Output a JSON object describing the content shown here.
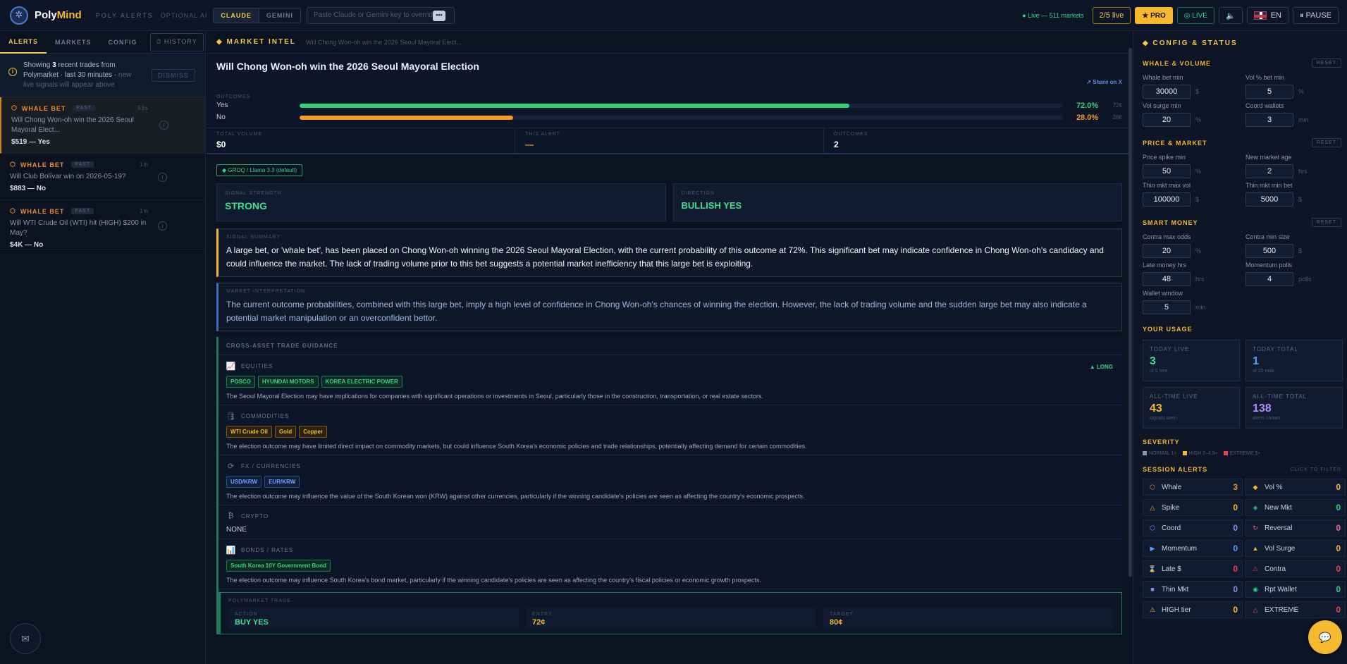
{
  "header": {
    "brand_a": "Poly",
    "brand_b": "Mind",
    "subtitle": "POLY ALERTS",
    "optional": "OPTIONAL AI",
    "seg_claude": "CLAUDE",
    "seg_gemini": "GEMINI",
    "key_placeholder": "Paste Claude or Gemini key to override",
    "key_btn": "•••",
    "live_markets": "● Live — 511 markets",
    "live_count": "2/5 live",
    "pro": "★ PRO",
    "live": "◎ LIVE",
    "sound": "🔈",
    "lang": "EN",
    "pause": "⏸ PAUSE"
  },
  "left": {
    "tabs": [
      "ALERTS",
      "MARKETS",
      "CONFIG"
    ],
    "history": "⏱ HISTORY",
    "notice_a": "Showing ",
    "notice_count": "3",
    "notice_b": " recent trades from Polymarket · last 30 minutes · ",
    "notice_muted": "new live signals will appear above",
    "dismiss": "DISMISS",
    "alerts": [
      {
        "type": "WHALE BET",
        "badge": "PAST",
        "age": "53s",
        "title": "Will Chong Won-oh win the 2026 Seoul Mayoral Elect...",
        "value": "$519 — Yes"
      },
      {
        "type": "WHALE BET",
        "badge": "PAST",
        "age": "1m",
        "title": "Will Club Bolívar win on 2026-05-19?",
        "value": "$883 — No"
      },
      {
        "type": "WHALE BET",
        "badge": "PAST",
        "age": "1m",
        "title": "Will WTI Crude Oil (WTI) hit (HIGH) $200 in May?",
        "value": "$4K — No"
      }
    ]
  },
  "center": {
    "section": "MARKET INTEL",
    "crumb": "Will Chong Won-oh win the 2026 Seoul Mayoral Elect...",
    "title": "Will Chong Won-oh win the 2026 Seoul Mayoral Election",
    "share": "↗ Share on X",
    "outcomes_label": "OUTCOMES",
    "outcomes": [
      {
        "name": "Yes",
        "pct": "72.0%",
        "pct_value": 0.72,
        "cents": "72¢",
        "color": "#2fd27a"
      },
      {
        "name": "No",
        "pct": "28.0%",
        "pct_value": 0.28,
        "cents": "28¢",
        "color": "#f39a2b"
      }
    ],
    "stats": [
      {
        "label": "TOTAL VOLUME",
        "value": "$0",
        "color": "#ffffff"
      },
      {
        "label": "THIS ALERT",
        "value": "—",
        "color": "#f39a2b"
      },
      {
        "label": "OUTCOMES",
        "value": "2",
        "color": "#ffffff"
      }
    ],
    "model": "◆ GROQ / Llama 3.3 (default)",
    "strength_label": "SIGNAL STRENGTH",
    "strength": "STRONG",
    "direction_label": "DIRECTION",
    "direction": "BULLISH YES",
    "summary_label": "SIGNAL SUMMARY",
    "summary": "A large bet, or 'whale bet', has been placed on Chong Won-oh winning the 2026 Seoul Mayoral Election, with the current probability of this outcome at 72%. This significant bet may indicate confidence in Chong Won-oh's candidacy and could influence the market. The lack of trading volume prior to this bet suggests a potential market inefficiency that this large bet is exploiting.",
    "interp_label": "MARKET INTERPRETATION",
    "interp": "The current outcome probabilities, combined with this large bet, imply a high level of confidence in Chong Won-oh's chances of winning the election. However, the lack of trading volume and the sudden large bet may also indicate a potential market manipulation or an overconfident bettor.",
    "xa_label": "CROSS-ASSET TRADE GUIDANCE",
    "equities": {
      "label": "EQUITIES",
      "icon": "📈",
      "dir": "▲ LONG",
      "tags": [
        "POSCO",
        "HYUNDAI MOTORS",
        "KOREA ELECTRIC POWER"
      ],
      "desc": "The Seoul Mayoral Election may have implications for companies with significant operations or investments in Seoul, particularly those in the construction, transportation, or real estate sectors."
    },
    "commodities": {
      "label": "COMMODITIES",
      "icon": "🛢",
      "tags": [
        "WTI Crude Oil",
        "Gold",
        "Copper"
      ],
      "desc": "The election outcome may have limited direct impact on commodity markets, but could influence South Korea's economic policies and trade relationships, potentially affecting demand for certain commodities."
    },
    "fx": {
      "label": "FX / CURRENCIES",
      "icon": "⟳",
      "tags": [
        "USD/KRW",
        "EUR/KRW"
      ],
      "desc": "The election outcome may influence the value of the South Korean won (KRW) against other currencies, particularly if the winning candidate's policies are seen as affecting the country's economic prospects."
    },
    "crypto": {
      "label": "CRYPTO",
      "icon": "₿",
      "value": "NONE"
    },
    "bonds": {
      "label": "BONDS / RATES",
      "icon": "📊",
      "tags": [
        "South Korea 10Y Government Bond"
      ],
      "desc": "The election outcome may influence South Korea's bond market, particularly if the winning candidate's policies are seen as affecting the country's fiscal policies or economic growth prospects."
    },
    "trade_label": "POLYMARKET TRADE",
    "trade": [
      {
        "label": "ACTION",
        "value": "BUY YES",
        "color": "#3fe08f"
      },
      {
        "label": "ENTRY",
        "value": "72¢",
        "color": "#f5b82e"
      },
      {
        "label": "TARGET",
        "value": "80¢",
        "color": "#f5b82e"
      }
    ]
  },
  "right": {
    "title": "◆ CONFIG & STATUS",
    "reset": "RESET",
    "whale": {
      "title": "WHALE & VOLUME",
      "fields": [
        {
          "label": "Whale bet min",
          "value": "30000",
          "unit": "$"
        },
        {
          "label": "Vol % bet min",
          "value": "5",
          "unit": "%"
        },
        {
          "label": "Vol surge min",
          "value": "20",
          "unit": "%"
        },
        {
          "label": "Coord wallets",
          "value": "3",
          "unit": "min"
        }
      ]
    },
    "price": {
      "title": "PRICE & MARKET",
      "fields": [
        {
          "label": "Price spike min",
          "value": "50",
          "unit": "%"
        },
        {
          "label": "New market age",
          "value": "2",
          "unit": "hrs"
        },
        {
          "label": "Thin mkt max vol",
          "value": "100000",
          "unit": "$"
        },
        {
          "label": "Thin mkt min bet",
          "value": "5000",
          "unit": "$"
        }
      ]
    },
    "smart": {
      "title": "SMART MONEY",
      "fields": [
        {
          "label": "Contra max odds",
          "value": "20",
          "unit": "%"
        },
        {
          "label": "Contra min size",
          "value": "500",
          "unit": "$"
        },
        {
          "label": "Late money hrs",
          "value": "48",
          "unit": "hrs"
        },
        {
          "label": "Momentum polls",
          "value": "4",
          "unit": "polls"
        },
        {
          "label": "Wallet window",
          "value": "5",
          "unit": "min"
        }
      ]
    },
    "usage_title": "YOUR USAGE",
    "usage": [
      {
        "label": "TODAY LIVE",
        "value": "3",
        "sub": "of 5 free",
        "color": "#3fe08f"
      },
      {
        "label": "TODAY TOTAL",
        "value": "1",
        "sub": "of 20 max",
        "color": "#5b9dff"
      },
      {
        "label": "ALL-TIME LIVE",
        "value": "43",
        "sub": "signals seen",
        "color": "#f5b82e"
      },
      {
        "label": "ALL-TIME TOTAL",
        "value": "138",
        "sub": "alerts shown",
        "color": "#b28cff"
      }
    ],
    "severity_title": "SEVERITY",
    "severity": [
      {
        "label": "NORMAL 1+",
        "color": "#8a97ae"
      },
      {
        "label": "HIGH 2–4.9+",
        "color": "#f5b82e"
      },
      {
        "label": "EXTREME 5+",
        "color": "#e5484d"
      }
    ],
    "session_title": "SESSION ALERTS",
    "session_hint": "CLICK TO FILTER",
    "session": [
      {
        "icon": "⬡",
        "label": "Whale",
        "count": "3",
        "color": "#f08c2c",
        "ncolor": "#f08c2c"
      },
      {
        "icon": "◆",
        "label": "Vol %",
        "count": "0",
        "color": "#f5b82e",
        "ncolor": "#f5b82e"
      },
      {
        "icon": "△",
        "label": "Spike",
        "count": "0",
        "color": "#f5b82e",
        "ncolor": "#f5b82e"
      },
      {
        "icon": "◈",
        "label": "New Mkt",
        "count": "0",
        "color": "#2fd27a",
        "ncolor": "#2fd27a"
      },
      {
        "icon": "⬡",
        "label": "Coord",
        "count": "0",
        "color": "#8a8cff",
        "ncolor": "#8a8cff"
      },
      {
        "icon": "↻",
        "label": "Reversal",
        "count": "0",
        "color": "#ff5fa2",
        "ncolor": "#ff5fa2"
      },
      {
        "icon": "▶",
        "label": "Momentum",
        "count": "0",
        "color": "#5b9dff",
        "ncolor": "#5b9dff"
      },
      {
        "icon": "▲",
        "label": "Vol Surge",
        "count": "0",
        "color": "#f5b82e",
        "ncolor": "#f5b82e"
      },
      {
        "icon": "⌛",
        "label": "Late $",
        "count": "0",
        "color": "#e5484d",
        "ncolor": "#e5484d"
      },
      {
        "icon": "⚠",
        "label": "Contra",
        "count": "0",
        "color": "#e5484d",
        "ncolor": "#e5484d"
      },
      {
        "icon": "■",
        "label": "Thin Mkt",
        "count": "0",
        "color": "#8a8cff",
        "ncolor": "#8a8cff"
      },
      {
        "icon": "◉",
        "label": "Rpt Wallet",
        "count": "0",
        "color": "#2fd27a",
        "ncolor": "#2fd27a"
      },
      {
        "icon": "⚠",
        "label": "HIGH tier",
        "count": "0",
        "color": "#f5b82e",
        "ncolor": "#f5b82e"
      },
      {
        "icon": "△",
        "label": "EXTREME",
        "count": "0",
        "color": "#e5484d",
        "ncolor": "#e5484d"
      }
    ],
    "chat": "💬"
  }
}
